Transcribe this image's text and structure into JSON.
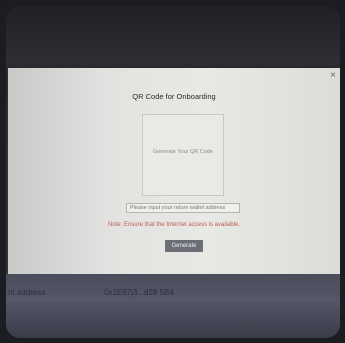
{
  "modal": {
    "title": "QR Code for Onboarding",
    "close_label": "×",
    "qr_placeholder": "Generate Your QR Code",
    "address_placeholder": "Please input your return wallet address",
    "note": "Note: Ensure that the Internet access is available.",
    "generate_label": "Generate"
  },
  "background": {
    "left_text": "nt address",
    "right_text": "0x1E67j3...d28 5B4"
  },
  "colors": {
    "note": "#c25a55",
    "button": "#6b6e74",
    "modal_bg": "#e6e6e3"
  },
  "icons": {
    "close": "close-icon"
  }
}
